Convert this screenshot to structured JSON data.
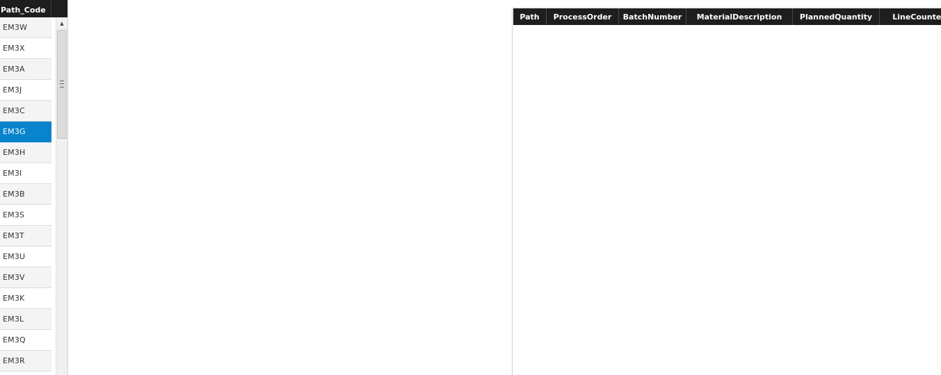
{
  "left_grid": {
    "header": "Path_Code",
    "rows": [
      "EM3W",
      "EM3X",
      "EM3A",
      "EM3J",
      "EM3C",
      "EM3G",
      "EM3H",
      "EM3I",
      "EM3B",
      "EM3S",
      "EM3T",
      "EM3U",
      "EM3V",
      "EM3K",
      "EM3L",
      "EM3Q",
      "EM3R"
    ],
    "selected": "EM3G",
    "selected_color": "#0984cc"
  },
  "right_grid": {
    "columns": [
      "Path",
      "ProcessOrder",
      "BatchNumber",
      "MaterialDescription",
      "PlannedQuantity",
      "LineCounter"
    ]
  },
  "scrollbar": {
    "up_arrow_icon": "triangle-up"
  }
}
